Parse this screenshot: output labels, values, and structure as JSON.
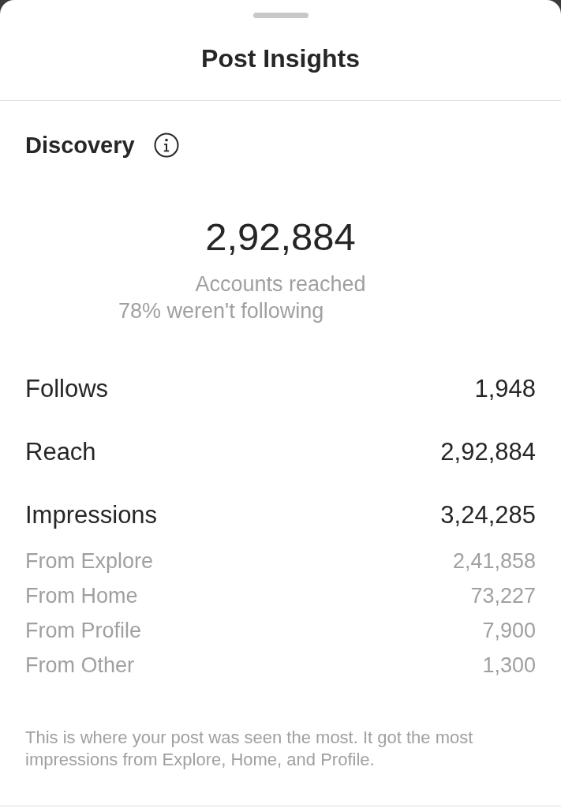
{
  "sheet": {
    "title": "Post Insights"
  },
  "section": {
    "title": "Discovery"
  },
  "summary": {
    "value": "2,92,884",
    "label": "Accounts reached",
    "note": "78% weren't following"
  },
  "metrics": [
    {
      "label": "Follows",
      "value": "1,948"
    },
    {
      "label": "Reach",
      "value": "2,92,884"
    },
    {
      "label": "Impressions",
      "value": "3,24,285",
      "breakdown": [
        {
          "label": "From Explore",
          "value": "2,41,858"
        },
        {
          "label": "From Home",
          "value": "73,227"
        },
        {
          "label": "From Profile",
          "value": "7,900"
        },
        {
          "label": "From Other",
          "value": "1,300"
        }
      ]
    }
  ],
  "footnote": "This is where your post was seen the most. It got the most impressions from Explore, Home, and Profile."
}
